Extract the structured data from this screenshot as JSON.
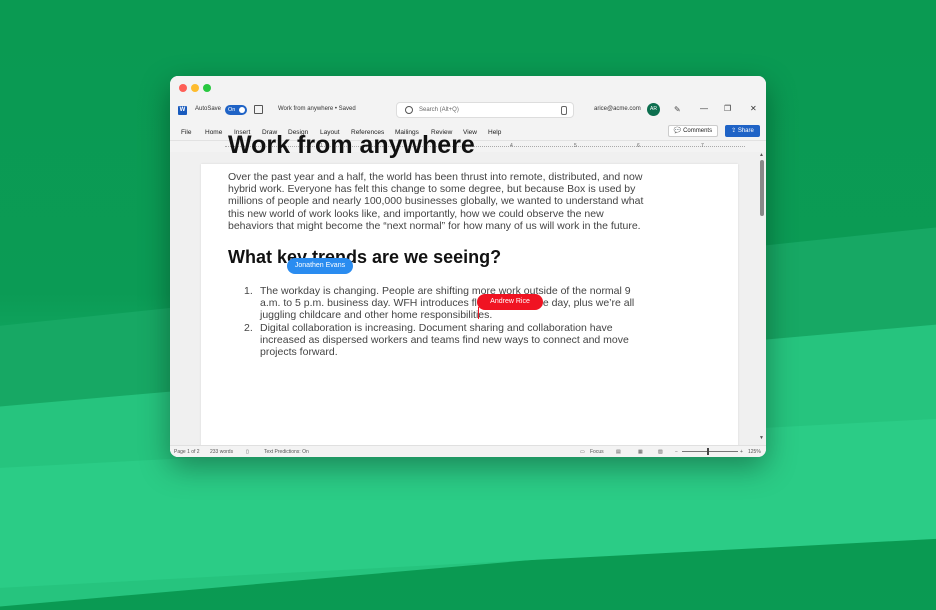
{
  "app": {
    "autosave_label": "AutoSave",
    "autosave_state": "On",
    "document_title": "Work from anywhere • Saved",
    "search_placeholder": "Search (Alt+Q)",
    "user_email": "arice@acme.com",
    "user_initials": "AR",
    "window_controls": {
      "minimize": "—",
      "restore": "❐",
      "close": "✕"
    }
  },
  "menu": {
    "items": [
      "File",
      "Home",
      "Insert",
      "Draw",
      "Design",
      "Layout",
      "References",
      "Mailings",
      "Review",
      "View",
      "Help"
    ],
    "comments_label": "Comments",
    "share_label": "Share"
  },
  "ruler": {
    "numbers": [
      "1",
      "2",
      "3",
      "4",
      "5",
      "6",
      "7"
    ]
  },
  "document": {
    "title": "Work from anywhere",
    "paragraph": "Over the past year and a half, the world has been thrust into remote, distributed, and now hybrid work. Everyone has felt this change to some degree, but because Box is used by millions of people and nearly 100,000 businesses globally, we wanted to understand what this new world of work looks like, and importantly, how we could observe the new behaviors that might become the “next normal” for how many of us will work in the future.",
    "heading2": "What key trends are we seeing?",
    "list": [
      {
        "num": "1.",
        "text": "The workday is changing. People are shifting more work outside of the normal 9 a.m. to 5 p.m. business day. WFH introduces flexibility into the day, plus we’re all juggling childcare and other home responsibilities."
      },
      {
        "num": "2.",
        "text": "Digital collaboration is increasing. Document sharing and collaboration have increased as dispersed workers and teams find new ways to connect and move projects forward."
      }
    ]
  },
  "collaborators": [
    {
      "name": "Jonathen Evans",
      "color": "#2a8cf0"
    },
    {
      "name": "Andrew Rice",
      "color": "#f01322"
    }
  ],
  "status": {
    "page": "Page 1 of 2",
    "words": "233 words",
    "predictions": "Text Predictions: On",
    "focus": "Focus",
    "zoom": "125%",
    "zoom_minus": "−",
    "zoom_plus": "+"
  },
  "colors": {
    "accent": "#1f63c6",
    "background": "#0a9a52"
  }
}
